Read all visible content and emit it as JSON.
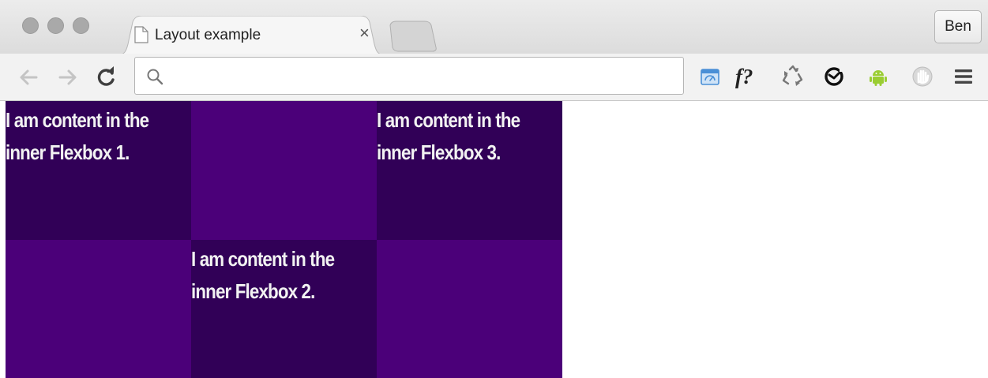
{
  "window": {
    "traffic_lights": [
      "close",
      "minimize",
      "zoom"
    ]
  },
  "tabs": [
    {
      "title": "Layout example",
      "close_glyph": "×",
      "icon": "document-icon"
    }
  ],
  "profile": {
    "name": "Ben"
  },
  "toolbar": {
    "back_icon": "back-arrow-icon",
    "forward_icon": "forward-arrow-icon",
    "reload_icon": "reload-icon",
    "omnibox": {
      "value": "",
      "icon": "search-icon"
    },
    "extensions": [
      {
        "name": "page-speed-extension-icon"
      },
      {
        "name": "font-finder-extension-icon",
        "label": "f?"
      },
      {
        "name": "recycle-extension-icon"
      },
      {
        "name": "sync-extension-icon"
      },
      {
        "name": "android-extension-icon"
      },
      {
        "name": "hand-extension-icon"
      },
      {
        "name": "menu-icon"
      }
    ]
  },
  "page": {
    "cells": [
      {
        "row": 1,
        "col": 1,
        "shade": "dark",
        "text_line1": "I am content in the",
        "text_line2": "inner Flexbox 1."
      },
      {
        "row": 1,
        "col": 2,
        "shade": "light",
        "text_line1": "",
        "text_line2": ""
      },
      {
        "row": 1,
        "col": 3,
        "shade": "dark",
        "text_line1": "I am content in the",
        "text_line2": "inner Flexbox 3."
      },
      {
        "row": 2,
        "col": 1,
        "shade": "light",
        "text_line1": "",
        "text_line2": ""
      },
      {
        "row": 2,
        "col": 2,
        "shade": "dark",
        "text_line1": "I am content in the",
        "text_line2": "inner Flexbox 2."
      },
      {
        "row": 2,
        "col": 3,
        "shade": "light",
        "text_line1": "",
        "text_line2": ""
      }
    ],
    "colors": {
      "light": "#4b0079",
      "dark": "#310057",
      "text": "#f2f2f2"
    }
  }
}
